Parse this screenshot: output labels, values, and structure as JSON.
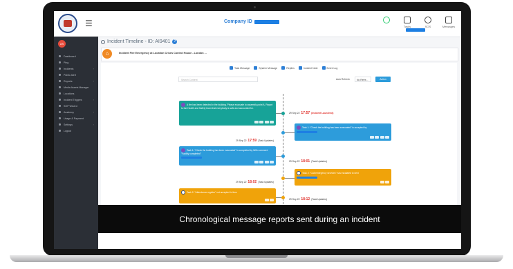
{
  "app": {
    "company_label": "Company ID",
    "title": "Incident Timeline - ID: AI9401",
    "incident_text": "Incident Fire Emergency at Location Crises Control House - London ...",
    "hamburger_icon": "menu-icon"
  },
  "toolbar": {
    "items": [
      {
        "label": "",
        "icon": "user-status-icon"
      },
      {
        "label": "Tasks",
        "icon": "list-icon"
      },
      {
        "label": "SOS",
        "icon": "alert-icon"
      },
      {
        "label": "Messages",
        "icon": "mail-icon"
      }
    ]
  },
  "sidebar": {
    "avatar": "AS",
    "items": [
      {
        "label": "Dashboard"
      },
      {
        "label": "Ping"
      },
      {
        "label": "Incidents"
      },
      {
        "label": "Public Alert"
      },
      {
        "label": "Reports"
      },
      {
        "label": "Media Assets Manager"
      },
      {
        "label": "Locations"
      },
      {
        "label": "Incident Triggers"
      },
      {
        "label": "SOP Wizard"
      },
      {
        "label": "Academy"
      },
      {
        "label": "Usage & Payment"
      },
      {
        "label": "Settings"
      },
      {
        "label": "Logout"
      }
    ]
  },
  "filters": {
    "items": [
      "Task Message",
      "System Message",
      "Replies",
      "Incident Note",
      "Event Log"
    ],
    "search_placeholder": "Search Content",
    "refresh_label": "Auto Refresh",
    "refresh_value": "No Refre...",
    "action_label": "Action"
  },
  "timeline": {
    "entries": [
      {
        "side": "left",
        "color": "#17a398",
        "text": "A fire has been detected in the building. Please evacuate to assembly point A. Report to the Health and Safety team that everybody is safe and accounted for.",
        "date": "29 Sep 22",
        "time": "17:57",
        "tag": "(Incident Launched)"
      },
      {
        "side": "right",
        "color": "#2d9cdb",
        "text": "Task 1: \"Check the building has been evacuated\" is accepted by",
        "date": "29 Sep 22",
        "time": "17:59",
        "tag": "(Task Updates)"
      },
      {
        "side": "left",
        "color": "#2d9cdb",
        "text": "Task 1: \"Check the building has been evacuated\" is completed by  With comment \"Facility completed\"",
        "date": "29 Sep 22",
        "time": "18:01",
        "tag": "(Task Updates)"
      },
      {
        "side": "right",
        "color": "#f0a30a",
        "text": "Task 2: \"Call emergency services\" has escalated to next",
        "date": "29 Sep 22",
        "time": "18:02",
        "tag": "(Task Updates)"
      },
      {
        "side": "left",
        "color": "#f0a30a",
        "text": "Task 2: \"Attendance register\" not accepted in time",
        "date": "29 Sep 22",
        "time": "18:12",
        "tag": "(Task Updates)"
      }
    ]
  },
  "caption": {
    "text": "Chronological message reports sent during an incident"
  },
  "colors": {
    "accent": "#2d7fd6",
    "teal": "#17a398",
    "blue": "#2d9cdb",
    "orange": "#f0a30a",
    "red": "#e0312b",
    "sidebar": "#2b2f36"
  }
}
